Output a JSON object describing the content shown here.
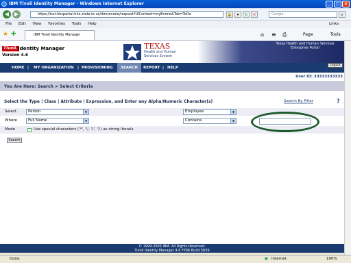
{
  "window": {
    "title": "IBM Tivoli Identity Manager - Windows Internet Explorer"
  },
  "addressbar": {
    "url": "https://isst.hhsportal.hhs.state.tx.us/itim/enrole/request?UIContext=myEnrole&Tab=ToDo",
    "search_placeholder": "Google",
    "links_label": "Links"
  },
  "menubar": {
    "items": [
      "File",
      "Edit",
      "View",
      "Favorites",
      "Tools",
      "Help"
    ]
  },
  "tabbar": {
    "tab_label": "IBM Tivoli Identity Manager",
    "page_label": "Page",
    "tools_label": "Tools"
  },
  "banner": {
    "tivoli": "Tivoli.",
    "product": "Identity Manager",
    "version": "Version 4.6",
    "agency_line1": "TEXAS",
    "agency_line2": "Health and Human",
    "agency_line3": "Services System",
    "portal_line1": "Texas Health and Human Services",
    "portal_line2": "Enterprise Portal"
  },
  "nav": {
    "items": [
      "HOME",
      "MY ORGANIZATION",
      "PROVISIONING",
      "SEARCH",
      "REPORT",
      "HELP"
    ],
    "logout": "Logout"
  },
  "user": {
    "id_label": "User ID: 33333333333"
  },
  "breadcrumb": "You Are Here: Search > Select Criteria",
  "criteria": {
    "heading": "Select the Type | Class | Attribute | Expression, and Enter any Alpha/Numeric Character(s)",
    "search_by_filter": "Search By Filter",
    "select_label": "Select",
    "where_label": "Where",
    "mode_label": "Mode",
    "type_value": "Person",
    "class_value": "Employee",
    "attribute_value": "Full Name",
    "expression_value": "Contains",
    "text_value": "",
    "mode_checkbox_label": "Use special characters ('*', '\\', '(', ')') as string literals",
    "search_button": "Search"
  },
  "footer": {
    "line1": "© 1999-2005 IBM. All Rights Reserved.",
    "line2": "Tivoli Identity Manager 4.6 FP06 Build 5839"
  },
  "status": {
    "left": "Done",
    "zone": "Internet",
    "zoom": "100%"
  }
}
